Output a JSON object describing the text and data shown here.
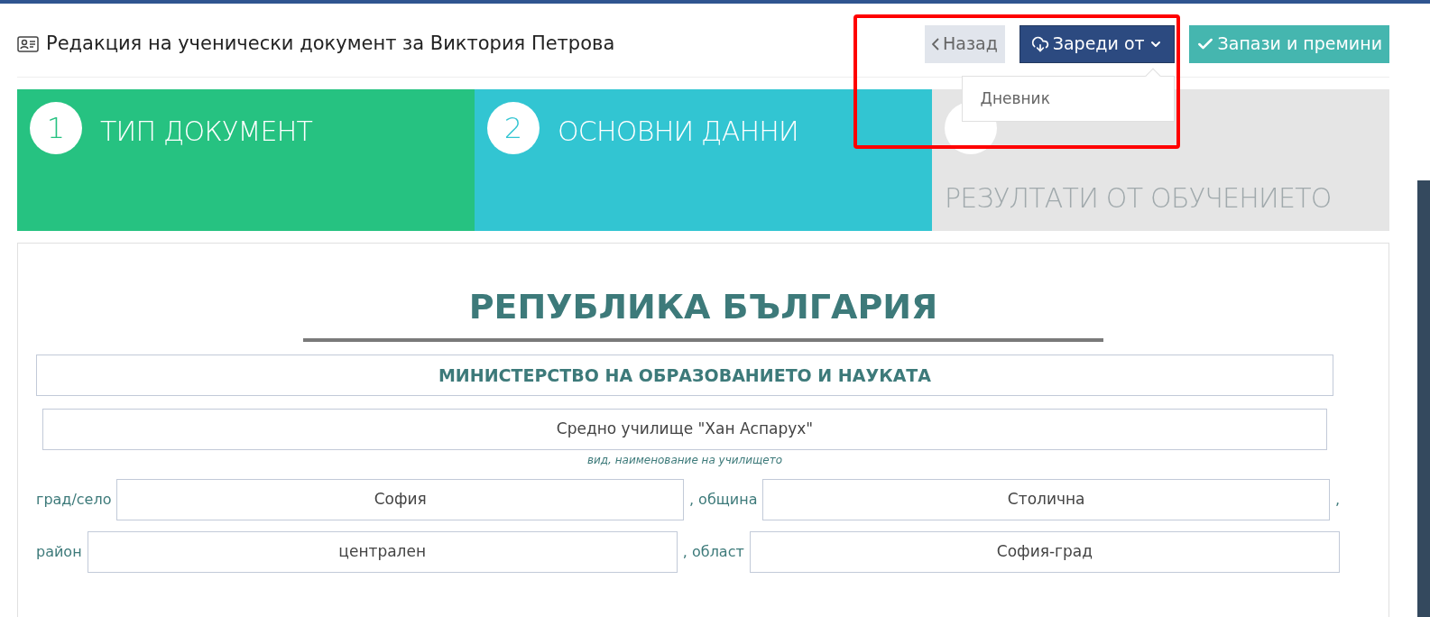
{
  "header": {
    "title": "Редакция на ученически документ за Виктория Петрова"
  },
  "actions": [
    {
      "kind": "back",
      "label": "Назад"
    },
    {
      "kind": "dropdown",
      "label": "Зареди от",
      "expanded": true,
      "menu": [
        "Дневник"
      ]
    },
    {
      "kind": "save",
      "label": "Запази и премини"
    }
  ],
  "annotation": {
    "highlighted": true
  },
  "steps": [
    {
      "number": "1",
      "label": "ТИП ДОКУМЕНТ",
      "kind": "done"
    },
    {
      "number": "2",
      "label": "ОСНОВНИ ДАННИ",
      "kind": "active"
    },
    {
      "label": "РЕЗУЛТАТИ ОТ ОБУЧЕНИЕТО",
      "kind": "pending"
    }
  ],
  "form": {
    "heading": "РЕПУБЛИКА БЪЛГАРИЯ",
    "ministry": "МИНИСТЕРСТВО НА ОБРАЗОВАНИЕТО И НАУКАТА",
    "school": {
      "value": "Средно училище \"Хан Аспарух\"",
      "hint": "вид, наименование на училището"
    },
    "rows": [
      [
        {
          "label": "град/село",
          "value": "София"
        },
        {
          "label": ", община",
          "value": "Столична"
        },
        {
          "label": ","
        }
      ],
      [
        {
          "label": "район",
          "value": "централен"
        },
        {
          "label": ", област",
          "value": "София-град"
        }
      ]
    ]
  }
}
